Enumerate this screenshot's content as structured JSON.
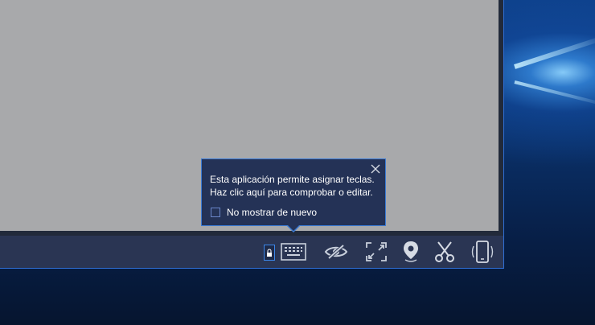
{
  "tooltip": {
    "line1": "Esta aplicación permite asignar teclas.",
    "line2": "Haz clic aquí para comprobar o editar.",
    "checkbox_label": "No mostrar de nuevo",
    "close_icon": "close-icon"
  },
  "toolbar": {
    "buttons": [
      {
        "icon": "keymap-lock-icon"
      },
      {
        "icon": "keyboard-icon"
      },
      {
        "icon": "eye-hidden-icon"
      },
      {
        "icon": "fullscreen-icon"
      },
      {
        "icon": "location-pin-icon"
      },
      {
        "icon": "scissors-icon"
      },
      {
        "icon": "shake-phone-icon"
      }
    ]
  },
  "colors": {
    "accent": "#3a7bd5",
    "toolbar_bg": "#2a3553",
    "screen_bg": "#a8a9ab",
    "tooltip_bg": "#243256"
  }
}
